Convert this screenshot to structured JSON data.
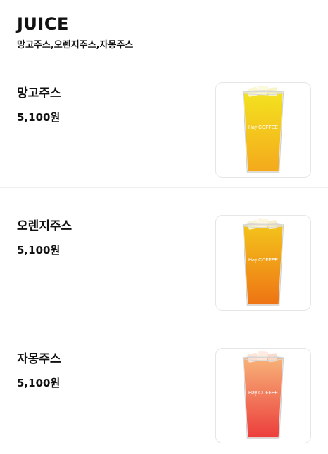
{
  "header": {
    "title": "JUICE",
    "subtitle": "망고주스,오렌지주스,자몽주스"
  },
  "menu": {
    "items": [
      {
        "name": "망고주스",
        "price": "5,100원",
        "cup_brand": "Hay COFFEE",
        "colors": {
          "top": "#f3e21f",
          "bottom": "#f4a91c"
        }
      },
      {
        "name": "오렌지주스",
        "price": "5,100원",
        "cup_brand": "Hay COFFEE",
        "colors": {
          "top": "#f3c31b",
          "bottom": "#ee7414"
        }
      },
      {
        "name": "자몽주스",
        "price": "5,100원",
        "cup_brand": "Hay COFFEE",
        "colors": {
          "top": "#f7b278",
          "bottom": "#ec3e3c"
        }
      }
    ]
  }
}
